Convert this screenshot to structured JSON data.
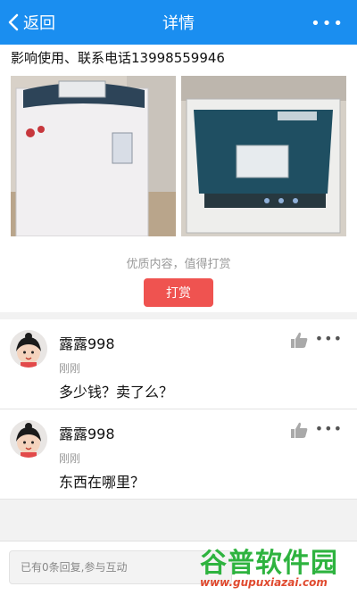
{
  "nav": {
    "back_label": "返回",
    "title": "详情",
    "more_label": "•••"
  },
  "post": {
    "text": "影响使用、联系电话13998559946",
    "reward_tip": "优质内容，值得打赏",
    "reward_button": "打赏"
  },
  "comments": [
    {
      "name": "露露998",
      "time": "刚刚",
      "text": "多少钱？卖了么？",
      "more": "•••"
    },
    {
      "name": "露露998",
      "time": "刚刚",
      "text": "东西在哪里？",
      "more": "•••"
    }
  ],
  "bottom": {
    "reply_placeholder": "已有0条回复,参与互动"
  },
  "watermark": {
    "name": "谷普软件园",
    "url": "www.gupuxiazai.com"
  },
  "colors": {
    "nav": "#1a8ef0",
    "reward": "#ef5350",
    "watermark_green": "#2eb33f",
    "watermark_red": "#e04a2f"
  }
}
